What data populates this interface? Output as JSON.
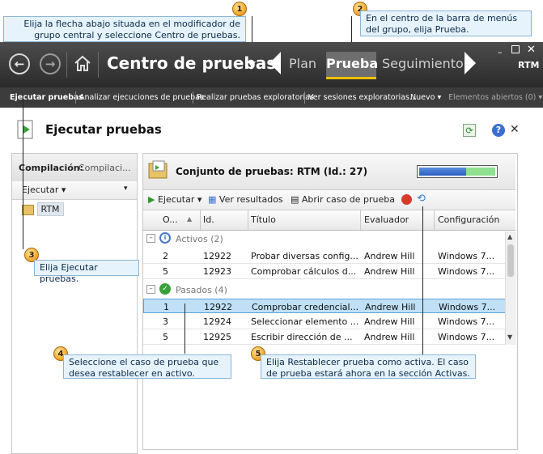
{
  "callouts": [
    {
      "num": "1",
      "text": "Elija la flecha abajo situada en el modificador de grupo central y seleccione Centro de pruebas."
    },
    {
      "num": "2",
      "text": "En el centro de la barra de menús del grupo, elija Prueba."
    },
    {
      "num": "3",
      "text": "Elija Ejecutar pruebas."
    },
    {
      "num": "4",
      "text": "Seleccione el caso de prueba que desea restablecer en activo."
    },
    {
      "num": "5",
      "text": "Elija Restablecer prueba como activa. El caso de prueba estará ahora en la sección Activas."
    }
  ],
  "header": {
    "title": "Centro de pruebas",
    "tabs": [
      "Plan",
      "Prueba",
      "Seguimiento"
    ],
    "active_tab": "Prueba",
    "project": "RTM"
  },
  "submenu": {
    "items": [
      "Ejecutar pruebas",
      "Analizar ejecuciones de pruebas",
      "Realizar pruebas exploratorias",
      "Ver sesiones exploratorias...",
      "Nuevo",
      "Elementos abiertos (0)"
    ]
  },
  "panel": {
    "title": "Ejecutar pruebas"
  },
  "left": {
    "build_label": "Compilación:",
    "build_value": "Compilaci...",
    "run_button": "Ejecutar",
    "tree_item": "RTM"
  },
  "right": {
    "suite_title": "Conjunto de pruebas: RTM (Id.: 27)",
    "progress_pass": 0.62,
    "toolbar": {
      "run": "Ejecutar",
      "view_results": "Ver resultados",
      "open_case": "Abrir caso de prueba"
    },
    "columns": [
      "O...",
      "Id.",
      "Título",
      "Evaluador",
      "Configuración"
    ],
    "groups": [
      {
        "label": "Activos (2)",
        "rows": [
          {
            "order": "2",
            "id": "12922",
            "title": "Probar diversas config...",
            "tester": "Andrew Hill",
            "config": "Windows 7..."
          },
          {
            "order": "5",
            "id": "12923",
            "title": "Comprobar cálculos d...",
            "tester": "Andrew Hill",
            "config": "Windows 7..."
          }
        ]
      },
      {
        "label": "Pasados (4)",
        "rows": [
          {
            "order": "1",
            "id": "12922",
            "title": "Comprobar credencial...",
            "tester": "Andrew Hill",
            "config": "Windows 7..."
          },
          {
            "order": "3",
            "id": "12924",
            "title": "Seleccionar elemento ...",
            "tester": "Andrew Hill",
            "config": "Windows 7..."
          },
          {
            "order": "5",
            "id": "12925",
            "title": "Escribir dirección de ...",
            "tester": "Andrew Hill",
            "config": "Windows 7..."
          }
        ]
      }
    ]
  },
  "colors": {
    "header_bg": "#3a3a3a",
    "active_tab_underline": "#f0c000",
    "selection": "#bfe0f6",
    "callout_bg": "#e6f3fc",
    "pass_green": "#6dd16d"
  }
}
